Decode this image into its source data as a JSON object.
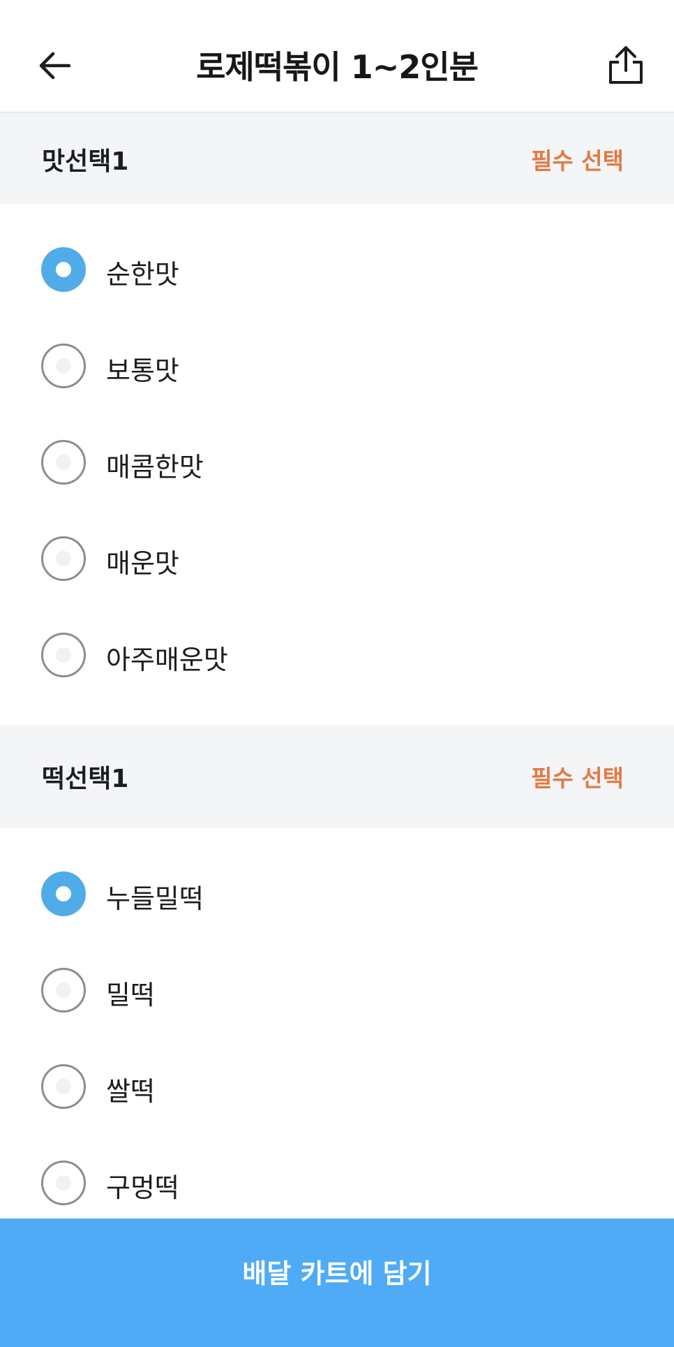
{
  "header": {
    "title": "로제떡볶이 1~2인분",
    "back_icon": "arrow-left-icon",
    "share_icon": "share-icon"
  },
  "sections": [
    {
      "title": "맛선택1",
      "badge": "필수 선택",
      "options": [
        {
          "label": "순한맛",
          "selected": true
        },
        {
          "label": "보통맛",
          "selected": false
        },
        {
          "label": "매콤한맛",
          "selected": false
        },
        {
          "label": "매운맛",
          "selected": false
        },
        {
          "label": "아주매운맛",
          "selected": false
        }
      ]
    },
    {
      "title": "떡선택1",
      "badge": "필수 선택",
      "options": [
        {
          "label": "누들밀떡",
          "selected": true
        },
        {
          "label": "밀떡",
          "selected": false
        },
        {
          "label": "쌀떡",
          "selected": false
        },
        {
          "label": "구멍떡",
          "selected": false
        }
      ]
    }
  ],
  "cta": {
    "label": "배달 카트에 담기"
  },
  "colors": {
    "accent": "#4fabf6",
    "radio_selected": "#4face8",
    "required": "#e27a45",
    "section_bg": "#f4f5f7"
  }
}
